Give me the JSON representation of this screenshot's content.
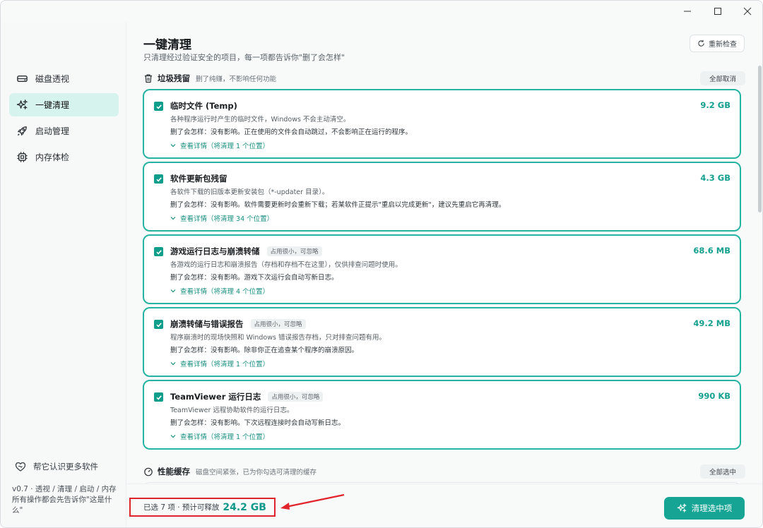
{
  "window": {
    "controls": [
      "minimize",
      "maximize",
      "close"
    ]
  },
  "sidebar": {
    "items": [
      {
        "label": "磁盘透视",
        "icon": "disk-icon",
        "active": false
      },
      {
        "label": "一键清理",
        "icon": "sparkle-icon",
        "active": true
      },
      {
        "label": "启动管理",
        "icon": "rocket-icon",
        "active": false
      },
      {
        "label": "内存体检",
        "icon": "chip-icon",
        "active": false
      }
    ],
    "footer_link": "帮它认识更多软件",
    "version_note": "v0.7 · 透视 / 清理 / 启动 / 内存\n所有操作都会先告诉你\"这是什么\""
  },
  "header": {
    "title": "一键清理",
    "subtitle": "只清理经过验证安全的项目，每一项都告诉你\"删了会怎样\"",
    "recheck_label": "重新检查"
  },
  "sections": [
    {
      "title": "垃圾残留",
      "note": "删了纯赚，不影响任何功能",
      "toggle_label": "全部取消",
      "items": [
        {
          "title": "临时文件 (Temp)",
          "tag": "",
          "desc": "各种程序运行时产生的临时文件，Windows 不会主动清空。",
          "impact": "删了会怎样：没有影响。正在使用的文件会自动跳过，不会影响正在运行的程序。",
          "detail": "查看详情（将清理 1 个位置）",
          "size": "9.2 GB",
          "checked": true
        },
        {
          "title": "软件更新包残留",
          "tag": "",
          "desc": "各软件下载的旧版本更新安装包（*-updater 目录）。",
          "impact": "删了会怎样：没有影响。软件需要更新时会重新下载；若某软件正提示\"重启以完成更新\"，建议先重启它再清理。",
          "detail": "查看详情（将清理 34 个位置）",
          "size": "4.3 GB",
          "checked": true
        },
        {
          "title": "游戏运行日志与崩溃转储",
          "tag": "占用很小，可忽略",
          "desc": "各游戏的运行日志和崩溃报告（存档和存档不在这里），仅供排查问题时使用。",
          "impact": "删了会怎样：没有影响。游戏下次运行会自动写新日志。",
          "detail": "查看详情（将清理 4 个位置）",
          "size": "68.6 MB",
          "checked": true
        },
        {
          "title": "崩溃转储与错误报告",
          "tag": "占用很小，可忽略",
          "desc": "程序崩溃时的现场快照和 Windows 错误报告存档，只对排查问题有用。",
          "impact": "删了会怎样：没有影响。除非你正在追查某个程序的崩溃原因。",
          "detail": "查看详情（将清理 1 个位置）",
          "size": "49.2 MB",
          "checked": true
        },
        {
          "title": "TeamViewer 运行日志",
          "tag": "占用很小，可忽略",
          "desc": "TeamViewer 远程协助软件的运行日志。",
          "impact": "删了会怎样：没有影响。下次远程连接时会自动写新日志。",
          "detail": "查看详情（将清理 1 个位置）",
          "size": "990 KB",
          "checked": true
        }
      ]
    },
    {
      "title": "性能缓存",
      "note": "磁盘空间紧张，已为你勾选可清理的缓存",
      "toggle_label": "全部选中",
      "items": []
    }
  ],
  "footer": {
    "summary_text": "已选 7 项 · 预计可释放",
    "summary_size": "24.2 GB",
    "clean_label": "清理选中项"
  },
  "colors": {
    "accent": "#16a595",
    "card_border": "#27b3a2",
    "highlight_box": "#e0242b"
  }
}
